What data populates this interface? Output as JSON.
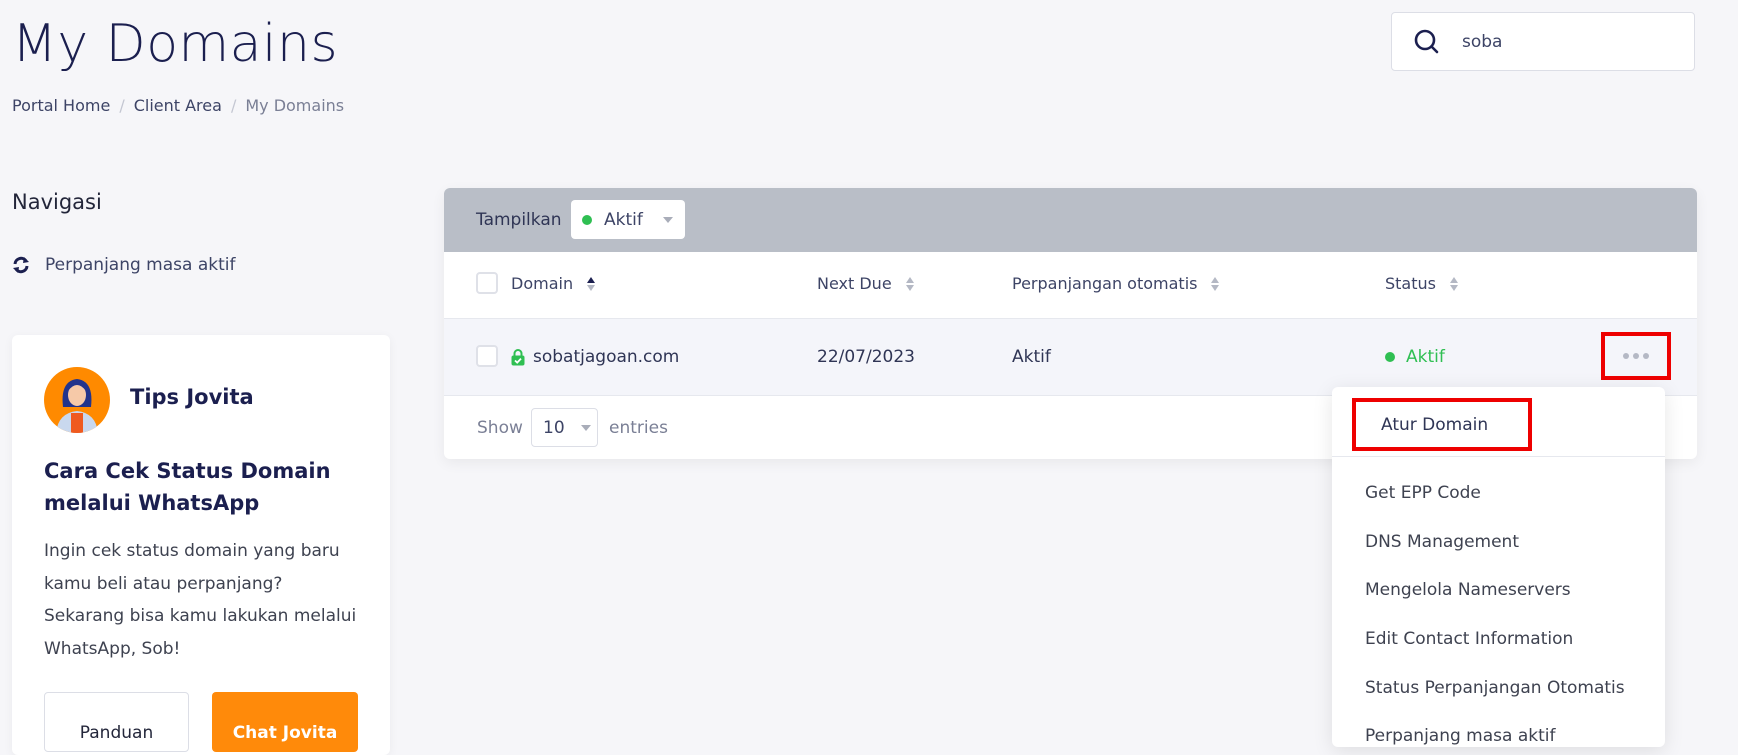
{
  "header": {
    "title": "My Domains",
    "breadcrumb": [
      "Portal Home",
      "Client Area",
      "My Domains"
    ],
    "breadcrumb_sep": "/"
  },
  "search": {
    "icon": "search-icon",
    "value": "soba"
  },
  "sidebar": {
    "title": "Navigasi",
    "items": [
      {
        "icon": "refresh-icon",
        "label": "Perpanjang masa aktif"
      }
    ]
  },
  "tips": {
    "avatar": "jovita-avatar",
    "name": "Tips Jovita",
    "heading": "Cara Cek Status Domain melalui WhatsApp",
    "body": "Ingin cek status domain yang baru kamu beli atau perpanjang? Sekarang bisa kamu lakukan melalui WhatsApp, Sob!",
    "buttons": {
      "guide": "Panduan",
      "chat": "Chat Jovita"
    },
    "accent_color": "#ff8a0a"
  },
  "table": {
    "toolbar": {
      "label": "Tampilkan",
      "filter_value": "Aktif",
      "filter_color": "#2fbf52"
    },
    "columns": [
      "Domain",
      "Next Due",
      "Perpanjangan otomatis",
      "Status"
    ],
    "sorted_column": "Domain",
    "rows": [
      {
        "domain": "sobatjagoan.com",
        "ssl_icon": "lock-check-icon",
        "next_due": "22/07/2023",
        "auto_renew": "Aktif",
        "status": "Aktif",
        "status_color": "#2fbf52"
      }
    ],
    "footer": {
      "show_label": "Show",
      "page_length": "10",
      "entries_label": "entries"
    }
  },
  "action_menu": {
    "highlight_color": "#ee0000",
    "items": [
      "Atur Domain",
      "Get EPP Code",
      "DNS Management",
      "Mengelola Nameservers",
      "Edit Contact Information",
      "Status Perpanjangan Otomatis",
      "Perpanjang masa aktif"
    ]
  }
}
